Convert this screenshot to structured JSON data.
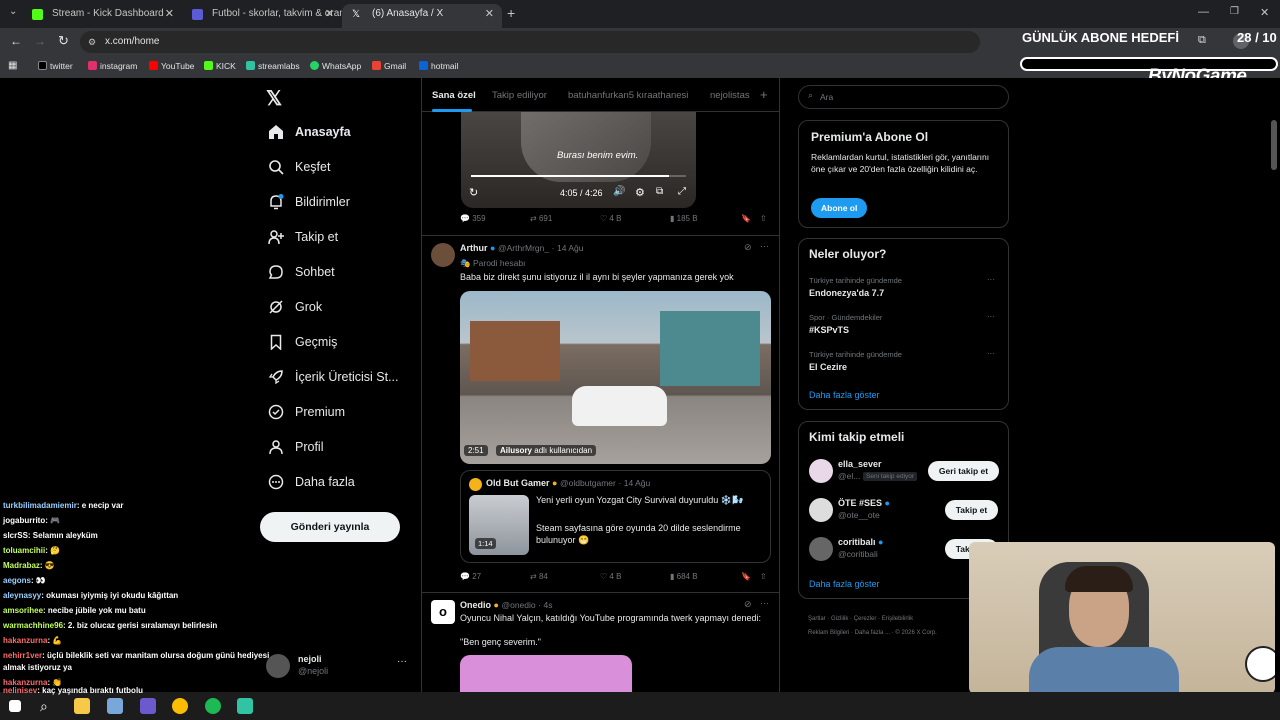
{
  "tabs": [
    {
      "title": "Stream - Kick Dashboard",
      "color": "#53fc18"
    },
    {
      "title": "Futbol - skorlar, takvim & oran",
      "color": "#5b5bd6"
    },
    {
      "title": "(6) Anasayfa / X",
      "color": "#ffffff"
    }
  ],
  "address": {
    "url": "x.com/home"
  },
  "bookmarks": [
    "twitter",
    "instagram",
    "YouTube",
    "KICK",
    "streamlabs",
    "WhatsApp",
    "Gmail",
    "hotmail"
  ],
  "overlay": {
    "goal_label": "GÜNLÜK ABONE HEDEFİ",
    "goal_count": "28 / 10",
    "brand": "ByNoGame"
  },
  "nav": {
    "items": [
      {
        "label": "Anasayfa",
        "icon": "home-icon"
      },
      {
        "label": "Keşfet",
        "icon": "search-icon"
      },
      {
        "label": "Bildirimler",
        "icon": "bell-icon"
      },
      {
        "label": "Takip et",
        "icon": "person-add-icon"
      },
      {
        "label": "Sohbet",
        "icon": "chat-icon"
      },
      {
        "label": "Grok",
        "icon": "grok-icon"
      },
      {
        "label": "Geçmiş",
        "icon": "bookmark-icon"
      },
      {
        "label": "İçerik Üreticisi St...",
        "icon": "rocket-icon"
      },
      {
        "label": "Premium",
        "icon": "verified-icon"
      },
      {
        "label": "Profil",
        "icon": "user-icon"
      },
      {
        "label": "Daha fazla",
        "icon": "more-icon"
      }
    ],
    "post_button": "Gönderi yayınla",
    "account": {
      "name": "nejoli",
      "handle": "@nejoli"
    }
  },
  "feed": {
    "tabs": [
      "Sana özel",
      "Takip ediliyor",
      "batuhanfurkan5 kıraathanesi",
      "nejolistas"
    ],
    "video1": {
      "caption": "Burası benim evim.",
      "time": "4:05 / 4:26"
    },
    "actions1": {
      "replies": "359",
      "reposts": "691",
      "likes": "4 B",
      "views": "185 B"
    },
    "post2": {
      "name": "Arthur",
      "handle": "@ArthrMrgn_",
      "date": "14 Ağu",
      "badge": "Parodi hesabı",
      "text": "Baba biz direkt şunu istiyoruz il il aynı bi şeyler yapmanıza gerek yok",
      "video_time": "2:51",
      "video_user": "Ailusory",
      "video_user_suffix": "adlı kullanıcıdan",
      "quote": {
        "name": "Old But Gamer",
        "handle": "@oldbutgamer",
        "date": "14 Ağu",
        "line1": "Yeni yerli oyun Yozgat City Survival duyuruldu ❄️🌬️",
        "line2": "Steam sayfasına göre oyunda 20 dilde seslendirme bulunuyor 😁",
        "thumb_time": "1:14"
      },
      "actions": {
        "replies": "27",
        "reposts": "84",
        "likes": "4 B",
        "views": "684 B"
      }
    },
    "post3": {
      "name": "Onedio",
      "handle": "@onedio",
      "date": "4s",
      "text": "Oyuncu Nihal Yalçın, katıldığı YouTube programında twerk yapmayı denedi:",
      "quote_text": "\"Ben genç severim.\""
    }
  },
  "right": {
    "search_placeholder": "Ara",
    "premium": {
      "title": "Premium'a Abone Ol",
      "desc": "Reklamlardan kurtul, istatistikleri gör, yanıtlarını öne çıkar ve 20'den fazla özelliğin kilidini aç.",
      "button": "Abone ol"
    },
    "trends": {
      "title": "Neler oluyor?",
      "items": [
        {
          "category": "Türkiye tarihinde gündemde",
          "name": "Endonezya'da 7.7"
        },
        {
          "category": "Spor · Gündemdekiler",
          "name": "#KSPvTS"
        },
        {
          "category": "Türkiye tarihinde gündemde",
          "name": "El Cezire"
        }
      ],
      "more": "Daha fazla göster"
    },
    "who_to_follow": {
      "title": "Kimi takip etmeli",
      "items": [
        {
          "name": "ella_sever",
          "handle": "@el...",
          "note": "Seni takip ediyor",
          "button": "Geri takip et"
        },
        {
          "name": "ÖTE #SES",
          "handle": "@ote__ote",
          "button": "Takip et"
        },
        {
          "name": "coritibalı",
          "handle": "@coritibali",
          "button": "Takip et"
        }
      ],
      "more": "Daha fazla göster"
    },
    "footer": [
      "Şartlar",
      "Gizlilik",
      "Çerezler",
      "Erişilebilirlik",
      "Reklam Bilgileri",
      "Daha fazla ...",
      "© 2026 X Corp."
    ]
  },
  "chat": [
    {
      "user": "turkbilimadamiemir",
      "msg": ": e necip var",
      "color": "#9ad0ff"
    },
    {
      "user": "jogaburrito",
      "msg": ": 🎮",
      "color": "#ffffff"
    },
    {
      "user": "slcrSS",
      "msg": ": Selamın aleyküm",
      "color": "#ffffff"
    },
    {
      "user": "toluamcihii",
      "msg": ": 🤔",
      "color": "#c3ff5e"
    },
    {
      "user": "Madrabaz",
      "msg": ": 😎",
      "color": "#c3ff5e"
    },
    {
      "user": "aegons",
      "msg": ": 👀",
      "color": "#9ad0ff"
    },
    {
      "user": "aleynasyy",
      "msg": ": okuması iyiymiş iyi okudu kâğıttan",
      "color": "#9ad0ff"
    },
    {
      "user": "amsorihee",
      "msg": ": necibe jübile yok mu batu",
      "color": "#c3ff5e"
    },
    {
      "user": "warmachhine96",
      "msg": ": 2. biz olucaz gerisi sıralamayı belirlesin",
      "color": "#c3ff5e"
    },
    {
      "user": "hakanzurna",
      "msg": ": 💪",
      "color": "#ff6b6b"
    },
    {
      "user": "nehirr1ver",
      "msg": ": üçlü bileklik seti var manitam olursa doğum günü hediyesi",
      "color": "#ff6b6b"
    },
    {
      "user": "",
      "msg": "almak istiyoruz ya",
      "color": "#ffffff"
    },
    {
      "user": "hakanzurna",
      "msg": ": 👏",
      "color": "#ff6b6b"
    },
    {
      "user": "nelinisev",
      "msg": ": kaç yaşında bıraktı futbolu",
      "color": "#ff6b6b"
    }
  ]
}
